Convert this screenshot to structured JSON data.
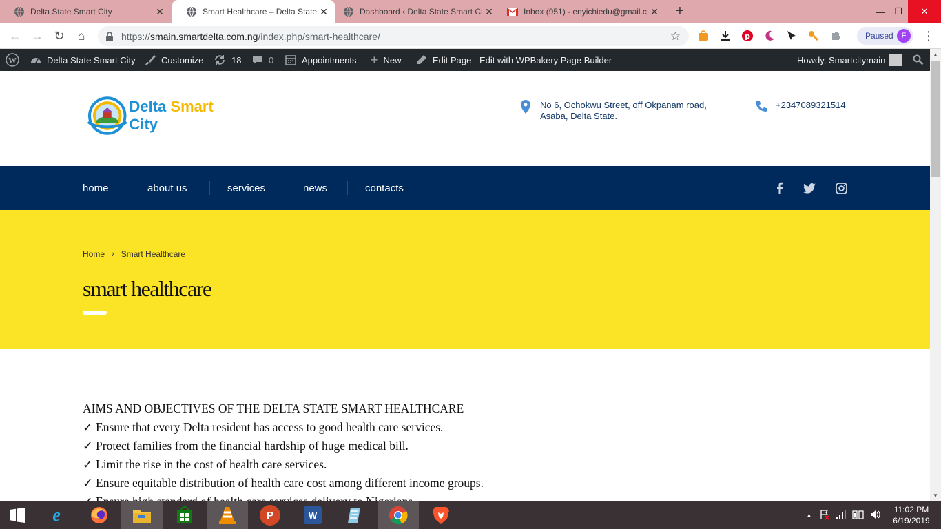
{
  "browser": {
    "tabs": [
      {
        "title": "Delta State Smart City",
        "active": false,
        "favicon": "globe-icon"
      },
      {
        "title": "Smart Healthcare – Delta State Sm",
        "active": true,
        "favicon": "globe-icon"
      },
      {
        "title": "Dashboard ‹ Delta State Smart Ci",
        "active": false,
        "favicon": "globe-icon"
      },
      {
        "title": "Inbox (951) - enyichiedu@gmail.c",
        "active": false,
        "favicon": "gmail-icon"
      }
    ],
    "url_prefix": "https://",
    "url_host": "smain.smartdelta.com.ng",
    "url_path": "/index.php/smart-healthcare/",
    "profile_status": "Paused",
    "profile_initial": "F"
  },
  "adminbar": {
    "site_name": "Delta State Smart City",
    "customize": "Customize",
    "updates_count": "18",
    "comments_count": "0",
    "appointments": "Appointments",
    "new": "New",
    "edit_page": "Edit Page",
    "wpbakery": "Edit with WPBakery Page Builder",
    "howdy": "Howdy, Smartcitymain"
  },
  "header": {
    "logo_part1": "Delta ",
    "logo_part2": "Smart",
    "logo_part3": " City",
    "address_line1": "No 6, Ochokwu Street, off Okpanam road,",
    "address_line2": "Asaba, Delta State.",
    "phone": "+2347089321514"
  },
  "nav": {
    "items": [
      "home",
      "about us",
      "services",
      "news",
      "contacts"
    ]
  },
  "hero": {
    "crumb_home": "Home",
    "crumb_sep": "›",
    "crumb_current": "Smart Healthcare",
    "title": "smart healthcare"
  },
  "content": {
    "lines": [
      "AIMS AND OBJECTIVES OF THE DELTA STATE SMART HEALTHCARE",
      "✓ Ensure that every Delta resident has access to good health care services.",
      "✓ Protect families from the financial hardship of huge medical bill.",
      "✓ Limit the rise in the cost of health care services.",
      "✓ Ensure equitable distribution of health care cost among different income groups.",
      "✓ Ensure high standard of health care services delivery to Nigerians."
    ]
  },
  "taskbar": {
    "time": "11:02 PM",
    "date": "6/19/2019"
  },
  "colors": {
    "tabbar": "#dfa8ac",
    "adminbar": "#23282d",
    "nav": "#002a5c",
    "hero": "#fbe325",
    "taskbar": "#3a3134"
  }
}
